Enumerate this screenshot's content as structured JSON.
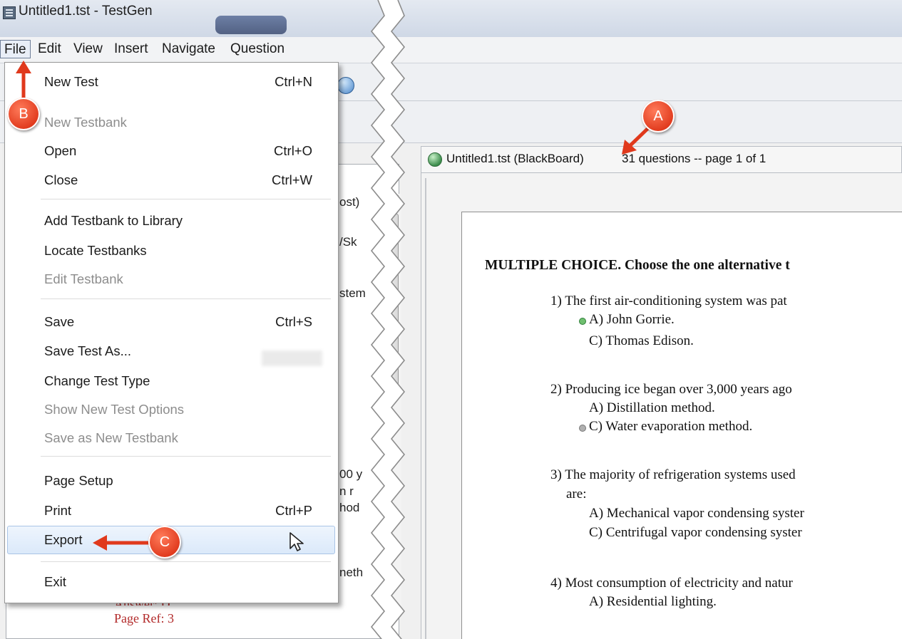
{
  "window": {
    "title": "Untitled1.tst - TestGen"
  },
  "menubar": {
    "items": [
      "File",
      "Edit",
      "View",
      "Insert",
      "Navigate",
      "Question"
    ]
  },
  "file_menu": {
    "items": [
      {
        "label": "New Test",
        "shortcut": "Ctrl+N",
        "enabled": true
      },
      {
        "label": "New Testbank",
        "shortcut": "",
        "enabled": false
      },
      {
        "label": "Open",
        "shortcut": "Ctrl+O",
        "enabled": true
      },
      {
        "label": "Close",
        "shortcut": "Ctrl+W",
        "enabled": true
      },
      {
        "label": "Add Testbank to Library",
        "shortcut": "",
        "enabled": true
      },
      {
        "label": "Locate Testbanks",
        "shortcut": "",
        "enabled": true
      },
      {
        "label": "Edit Testbank",
        "shortcut": "",
        "enabled": false
      },
      {
        "label": "Save",
        "shortcut": "Ctrl+S",
        "enabled": true
      },
      {
        "label": "Save Test As...",
        "shortcut": "",
        "enabled": true
      },
      {
        "label": "Change Test Type",
        "shortcut": "",
        "enabled": true
      },
      {
        "label": "Show New Test Options",
        "shortcut": "",
        "enabled": false
      },
      {
        "label": "Save as New Testbank",
        "shortcut": "",
        "enabled": false
      },
      {
        "label": "Page Setup",
        "shortcut": "",
        "enabled": true
      },
      {
        "label": "Print",
        "shortcut": "Ctrl+P",
        "enabled": true
      },
      {
        "label": "Export",
        "shortcut": "",
        "enabled": true
      },
      {
        "label": "Exit",
        "shortcut": "",
        "enabled": true
      }
    ]
  },
  "left_panel": {
    "peek": [
      "ost)",
      "/Sk",
      "stem",
      "00 y",
      "n r",
      "hod",
      "neth"
    ],
    "answer_fragment": "Answer: D",
    "page_ref": "Page Ref: 3"
  },
  "document_tab": {
    "title": "Untitled1.tst (BlackBoard)",
    "info": "31 questions -- page 1 of 1"
  },
  "document": {
    "heading": "MULTIPLE CHOICE.  Choose the one alternative t",
    "questions": [
      {
        "stem": "1) The first air-conditioning system was pat",
        "options": [
          "A) John Gorrie.",
          "C) Thomas Edison."
        ]
      },
      {
        "stem": "2) Producing ice began over 3,000 years ago",
        "options": [
          "A) Distillation method.",
          "C) Water evaporation method."
        ]
      },
      {
        "stem": "3) The majority of refrigeration systems used",
        "stem_cont": "are:",
        "options": [
          "A) Mechanical vapor condensing syster",
          "C) Centrifugal vapor condensing syster"
        ]
      },
      {
        "stem": "4) Most consumption of electricity and natur",
        "options": [
          "A) Residential lighting."
        ]
      }
    ]
  },
  "callouts": {
    "a": "A",
    "b": "B",
    "c": "C"
  },
  "colors": {
    "callout": "#e0391c",
    "disabled_text": "#8d8d8d",
    "page_ref": "#b22a2a"
  }
}
